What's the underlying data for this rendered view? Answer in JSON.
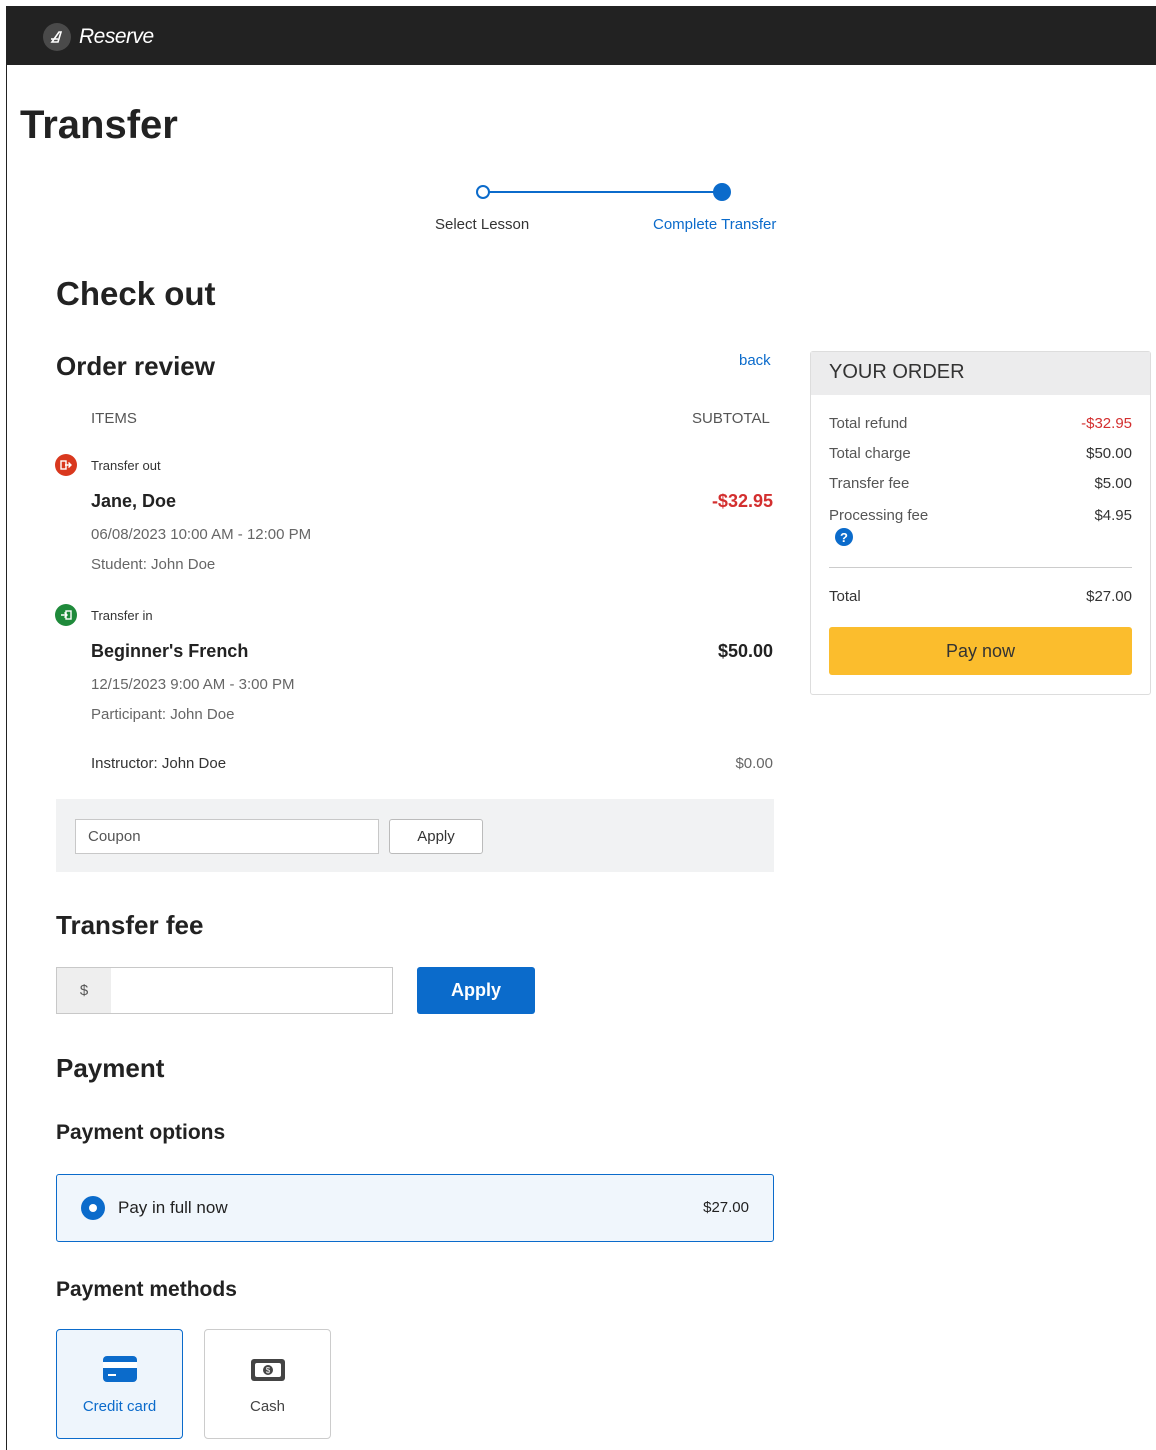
{
  "app": {
    "name": "Reserve"
  },
  "page_title": "Transfer",
  "stepper": {
    "steps": [
      "Select Lesson",
      "Complete Transfer"
    ]
  },
  "checkout": {
    "title": "Check out",
    "order_review": {
      "title": "Order review",
      "back_label": "back",
      "col_items": "ITEMS",
      "col_subtotal": "SUBTOTAL",
      "transfer_out": {
        "tag": "Transfer out",
        "name": "Jane, Doe",
        "amount": "-$32.95",
        "datetime": "06/08/2023 10:00 AM - 12:00 PM",
        "student": "Student: John Doe"
      },
      "transfer_in": {
        "tag": "Transfer in",
        "name": "Beginner's French",
        "amount": "$50.00",
        "datetime": "12/15/2023 9:00 AM - 3:00 PM",
        "participant": "Participant: John Doe",
        "instructor": "Instructor: John Doe",
        "instructor_amount": "$0.00"
      },
      "coupon": {
        "placeholder": "Coupon",
        "apply_label": "Apply"
      }
    },
    "transfer_fee": {
      "title": "Transfer fee",
      "currency": "$",
      "value": "",
      "apply_label": "Apply"
    },
    "payment": {
      "title": "Payment",
      "options_title": "Payment options",
      "option": {
        "label": "Pay in full now",
        "amount": "$27.00"
      },
      "methods_title": "Payment methods",
      "methods": [
        {
          "label": "Credit card",
          "icon": "credit-card-icon",
          "selected": true
        },
        {
          "label": "Cash",
          "icon": "cash-icon",
          "selected": false
        }
      ]
    }
  },
  "your_order": {
    "title": "YOUR ORDER",
    "rows": [
      {
        "label": "Total refund",
        "value": "-$32.95"
      },
      {
        "label": "Total charge",
        "value": "$50.00"
      },
      {
        "label": "Transfer fee",
        "value": "$5.00"
      },
      {
        "label": "Processing fee",
        "value": "$4.95"
      }
    ],
    "total_label": "Total",
    "total_value": "$27.00",
    "pay_label": "Pay now"
  },
  "colors": {
    "primary": "#0b6bcb",
    "negative": "#d32f2f",
    "transfer_in": "#1f8a3b",
    "transfer_out": "#d9381e",
    "pay_button": "#fbbd2d",
    "topbar": "#222222"
  }
}
